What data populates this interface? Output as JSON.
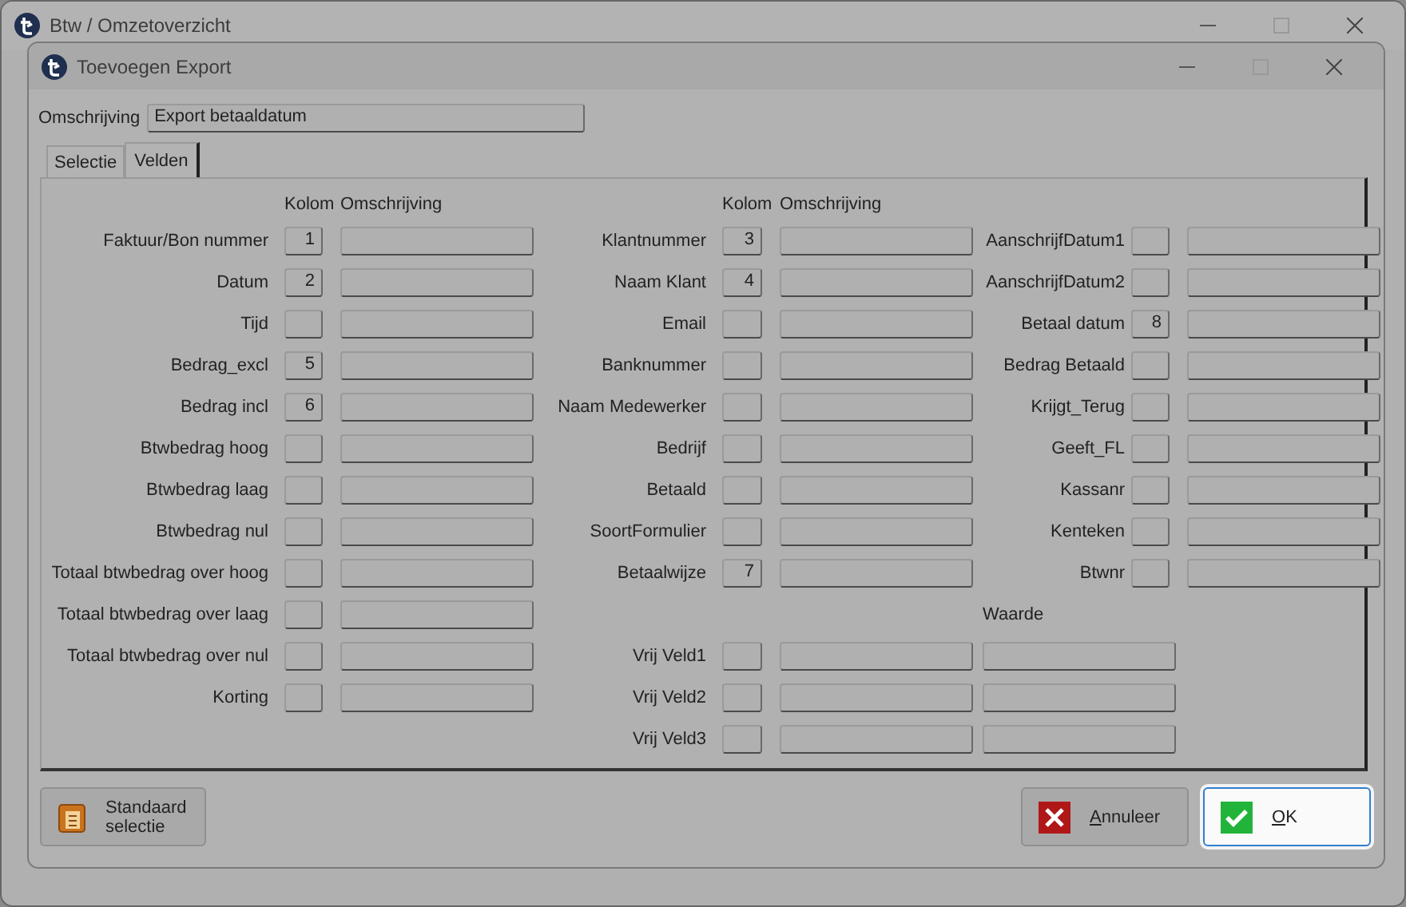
{
  "window": {
    "title": "Btw / Omzetoverzicht"
  },
  "dialog": {
    "title": "Toevoegen Export",
    "description": {
      "label": "Omschrijving",
      "value": "Export betaaldatum"
    },
    "tabs": [
      {
        "label": "Selectie",
        "selected": false
      },
      {
        "label": "Velden",
        "selected": true
      }
    ],
    "field_groups": [
      {
        "header": {
          "kolom": "Kolom",
          "omschrijving": "Omschrijving"
        },
        "fields": [
          {
            "label": "Faktuur/Bon nummer",
            "kolom": "1"
          },
          {
            "label": "Datum",
            "kolom": "2"
          },
          {
            "label": "Tijd"
          },
          {
            "label": "Bedrag_excl",
            "kolom": "5"
          },
          {
            "label": "Bedrag incl",
            "kolom": "6"
          },
          {
            "label": "Btwbedrag hoog"
          },
          {
            "label": "Btwbedrag laag"
          },
          {
            "label": "Btwbedrag nul"
          },
          {
            "label": "Totaal btwbedrag over hoog"
          },
          {
            "label": "Totaal btwbedrag over laag"
          },
          {
            "label": "Totaal btwbedrag over nul"
          },
          {
            "label": "Korting"
          }
        ]
      },
      {
        "header": {
          "kolom": "Kolom",
          "omschrijving": "Omschrijving"
        },
        "fields": [
          {
            "label": "Klantnummer",
            "kolom": "3"
          },
          {
            "label": "Naam Klant",
            "kolom": "4"
          },
          {
            "label": "Email"
          },
          {
            "label": "Banknummer"
          },
          {
            "label": "Naam Medewerker"
          },
          {
            "label": "Bedrijf"
          },
          {
            "label": "Betaald"
          },
          {
            "label": "SoortFormulier"
          },
          {
            "label": "Betaalwijze",
            "kolom": "7"
          }
        ]
      },
      {
        "fields": [
          {
            "label": "AanschrijfDatum1"
          },
          {
            "label": "AanschrijfDatum2"
          },
          {
            "label": "Betaal datum",
            "kolom": "8"
          },
          {
            "label": "Bedrag Betaald"
          },
          {
            "label": "Krijgt_Terug"
          },
          {
            "label": "Geeft_FL"
          },
          {
            "label": "Kassanr"
          },
          {
            "label": "Kenteken"
          },
          {
            "label": "Btwnr"
          }
        ]
      }
    ],
    "free_fields": {
      "header": "Waarde",
      "fields": [
        {
          "label": "Vrij Veld1"
        },
        {
          "label": "Vrij Veld2"
        },
        {
          "label": "Vrij Veld3"
        }
      ]
    },
    "buttons": [
      {
        "kind": "standard",
        "label": "Standaard selectie",
        "focused": false
      },
      {
        "kind": "cancel",
        "label": "Annuleer",
        "focused": false
      },
      {
        "kind": "ok",
        "label": "OK",
        "focused": true
      }
    ]
  }
}
